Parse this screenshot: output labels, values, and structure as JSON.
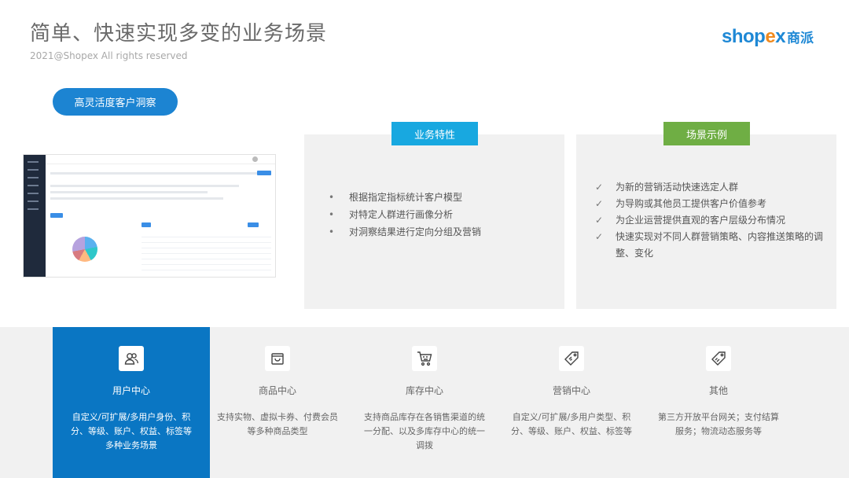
{
  "header": {
    "title": "简单、快速实现多变的业务场景",
    "copyright": "2021@Shopex All rights reserved",
    "logo_brand_a": "shop",
    "logo_brand_x": "e",
    "logo_brand_b": "x",
    "logo_cn": "商派"
  },
  "feature_pill": "高灵活度客户洞察",
  "business": {
    "tag": "业务特性",
    "items": [
      "根据指定指标统计客户模型",
      "对特定人群进行画像分析",
      "对洞察结果进行定向分组及营销"
    ]
  },
  "scenario": {
    "tag": "场景示例",
    "items": [
      "为新的营销活动快速选定人群",
      "为导购或其他员工提供客户价值参考",
      "为企业运营提供直观的客户层级分布情况",
      "快速实现对不同人群营销策略、内容推送策略的调整、变化"
    ]
  },
  "modules": [
    {
      "label": "用户中心",
      "desc": "自定义/可扩展/多用户身份、积分、等级、账户、权益、标签等多种业务场景",
      "icon": "users-icon",
      "active": true
    },
    {
      "label": "商品中心",
      "desc": "支持实物、虚拟卡券、付费会员等多种商品类型",
      "icon": "bag-icon",
      "active": false
    },
    {
      "label": "库存中心",
      "desc": "支持商品库存在各销售渠道的统一分配、以及多库存中心的统一调拨",
      "icon": "cart-icon",
      "active": false
    },
    {
      "label": "营销中心",
      "desc": "自定义/可扩展/多用户类型、积分、等级、账户、权益、标签等",
      "icon": "tag-icon",
      "active": false
    },
    {
      "label": "其他",
      "desc": "第三方开放平台网关；支付结算服务；物流动态服务等",
      "icon": "sale-tag-icon",
      "active": false
    }
  ],
  "colors": {
    "accent_blue": "#0a76c3",
    "tag_blue": "#18a8e0",
    "tag_green": "#6fae44",
    "brand_orange": "#f08a1e"
  }
}
